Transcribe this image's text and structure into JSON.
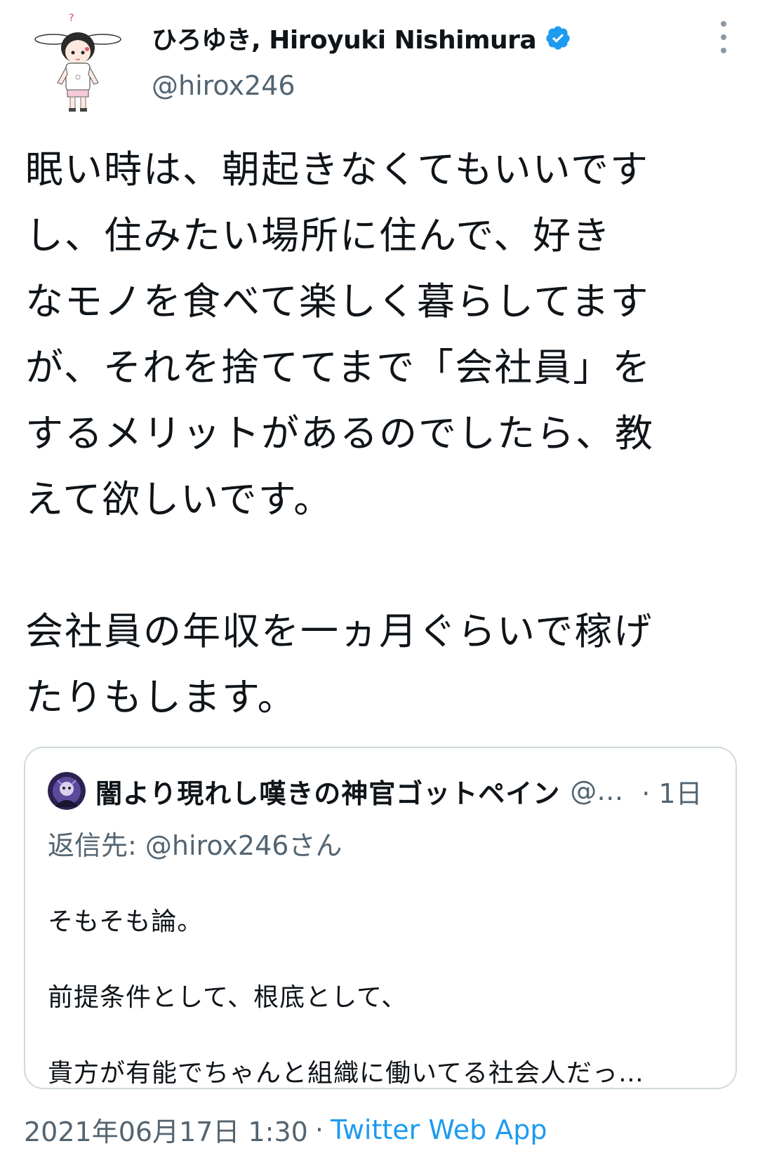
{
  "author": {
    "display_name": "ひろゆき, Hiroyuki Nishimura",
    "handle": "@hirox246",
    "verified": true,
    "avatar_icon": "bunny-girl-avatar-icon"
  },
  "tweet": {
    "lines_p1": [
      "眠い時は、朝起きなくてもいいです",
      "し、住みたい場所に住んで、好き",
      "なモノを食べて楽しく暮らしてます",
      "が、それを捨ててまで「会社員」を",
      "するメリットがあるのでしたら、教",
      "えて欲しいです。"
    ],
    "lines_p2": [
      "会社員の年収を一ヵ月ぐらいで稼げ",
      "たりもします。"
    ]
  },
  "quoted": {
    "display_name": "闇より現れし嘆きの神官ゴットペイン",
    "handle": "@…",
    "time": "· 1日",
    "reply_prefix": "返信先: ",
    "reply_handle": "@hirox246さん",
    "lines": [
      "そもそも論。",
      "前提条件として、根底として、",
      "貴方が有能でちゃんと組織に働いてる社会人だっ…"
    ]
  },
  "footer": {
    "timestamp": "2021年06月17日 1:30",
    "separator": "·",
    "source": "Twitter Web App"
  },
  "colors": {
    "text": "#0f1419",
    "secondary": "#536471",
    "accent": "#1d9bf0",
    "border": "#cfd9de"
  }
}
